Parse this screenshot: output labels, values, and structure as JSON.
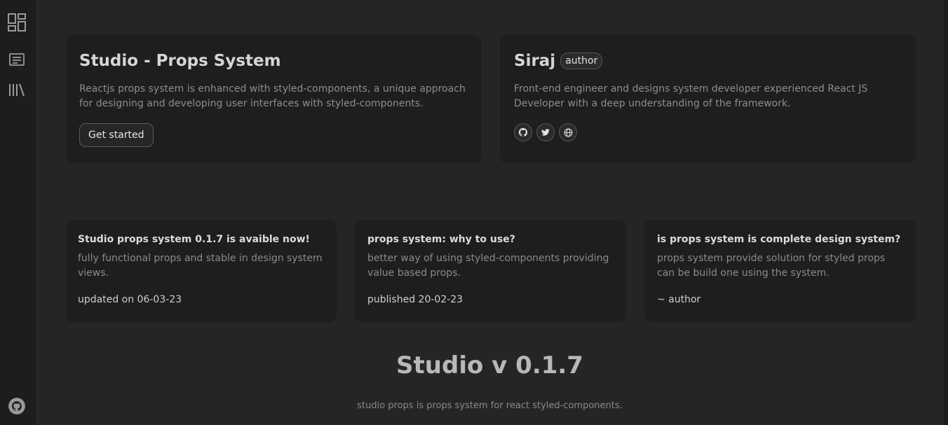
{
  "hero": {
    "title": "Studio - Props System",
    "description": "Reactjs props system is enhanced with styled-components, a unique approach for designing and developing user interfaces with styled-components.",
    "cta_label": "Get started"
  },
  "author_card": {
    "name": "Siraj",
    "badge": "author",
    "bio": "Front-end engineer and designs system developer experienced React JS Developer with a deep understanding of the framework.",
    "socials": [
      "github-icon",
      "twitter-icon",
      "globe-icon"
    ]
  },
  "info_cards": [
    {
      "title": "Studio props system 0.1.7 is avaible now!",
      "description": "fully functional props and stable in design system views.",
      "footer": "updated on 06-03-23"
    },
    {
      "title": "props system: why to use?",
      "description": "better way of using styled-components providing value based props.",
      "footer": "published 20-02-23"
    },
    {
      "title": "is props system is complete design system?",
      "description": "props system provide solution for styled props can be build one using the system.",
      "footer": "~ author"
    }
  ],
  "version": {
    "title": "Studio v 0.1.7",
    "subtitle": "studio props is props system for react styled-components."
  },
  "sidebar": {
    "items": [
      "dashboard-icon",
      "article-icon",
      "library-icon"
    ],
    "bottom": "github-icon"
  },
  "colors": {
    "background": "#252525",
    "sidebar": "#1d1d1d",
    "card": "#1e1e1e",
    "muted_text": "#8d8d8d"
  }
}
